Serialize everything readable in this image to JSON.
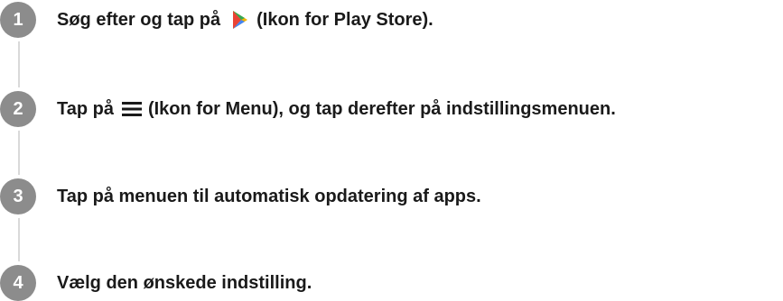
{
  "steps": [
    {
      "number": "1",
      "before_icon": "Søg efter og tap på",
      "icon": "play-store-icon",
      "after_icon": "(Ikon for Play Store)."
    },
    {
      "number": "2",
      "before_icon": "Tap på",
      "icon": "menu-icon",
      "after_icon": "(Ikon for Menu), og tap derefter på indstillingsmenuen."
    },
    {
      "number": "3",
      "text": "Tap på menuen til automatisk opdatering af apps."
    },
    {
      "number": "4",
      "text": "Vælg den ønskede indstilling."
    }
  ],
  "colors": {
    "badge": "#8c8c8c",
    "connector": "#d9d9d9",
    "text": "#1a1a1a"
  }
}
